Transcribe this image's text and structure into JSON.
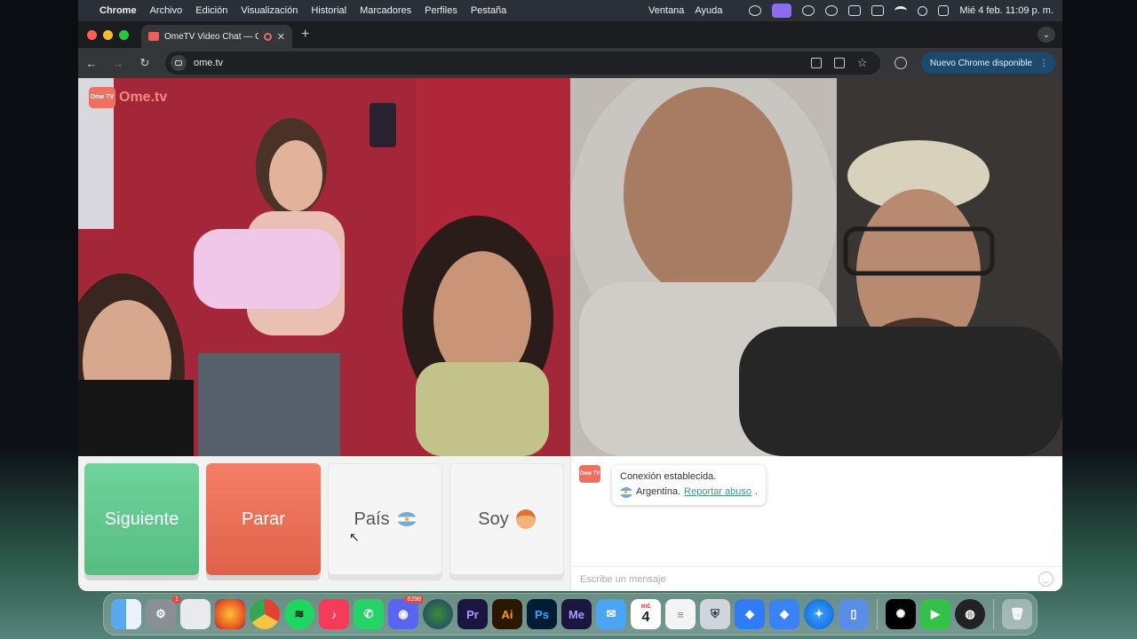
{
  "menubar": {
    "items": [
      "Chrome",
      "Archivo",
      "Edición",
      "Visualización",
      "Historial",
      "Marcadores",
      "Perfiles",
      "Pestaña"
    ],
    "right_items": [
      "Ventana",
      "Ayuda"
    ],
    "clock": "Mié 4 feb.  11:09 p. m."
  },
  "browser": {
    "tab_title": "OmeTV Video Chat — Om",
    "url": "ome.tv",
    "update_label": "Nuevo Chrome disponible"
  },
  "site": {
    "logo_text": "Ome.tv",
    "logo_badge": "Ome TV"
  },
  "controls": {
    "next_label": "Siguiente",
    "stop_label": "Parar",
    "country_label": "País",
    "gender_label": "Soy"
  },
  "chat": {
    "status": "Conexión establecida.",
    "country": "Argentina.",
    "report_link": "Reportar abuso",
    "report_suffix": ".",
    "input_placeholder": "Escribe un mensaje"
  },
  "dock": {
    "settings_badge": "1",
    "discord_badge": "8298",
    "calendar_month": "MIÉ",
    "calendar_day": "4",
    "apps": [
      "Finder",
      "System Settings",
      "Launchpad",
      "Firefox",
      "Chrome",
      "Spotify",
      "Music",
      "WhatsApp",
      "Discord",
      "Earth",
      "Premiere",
      "Illustrator",
      "Photoshop",
      "Media Encoder",
      "Mail",
      "Calendar",
      "Reminders",
      "Game",
      "Roblox",
      "Roblox Studio",
      "Safari",
      "Simulator",
      "ChatGPT",
      "FaceTime",
      "OBS",
      "Trash"
    ]
  },
  "colors": {
    "next": "#5cc58b",
    "stop": "#e96c55",
    "accent_link": "#3d9b7e",
    "brand": "#f06f60"
  }
}
